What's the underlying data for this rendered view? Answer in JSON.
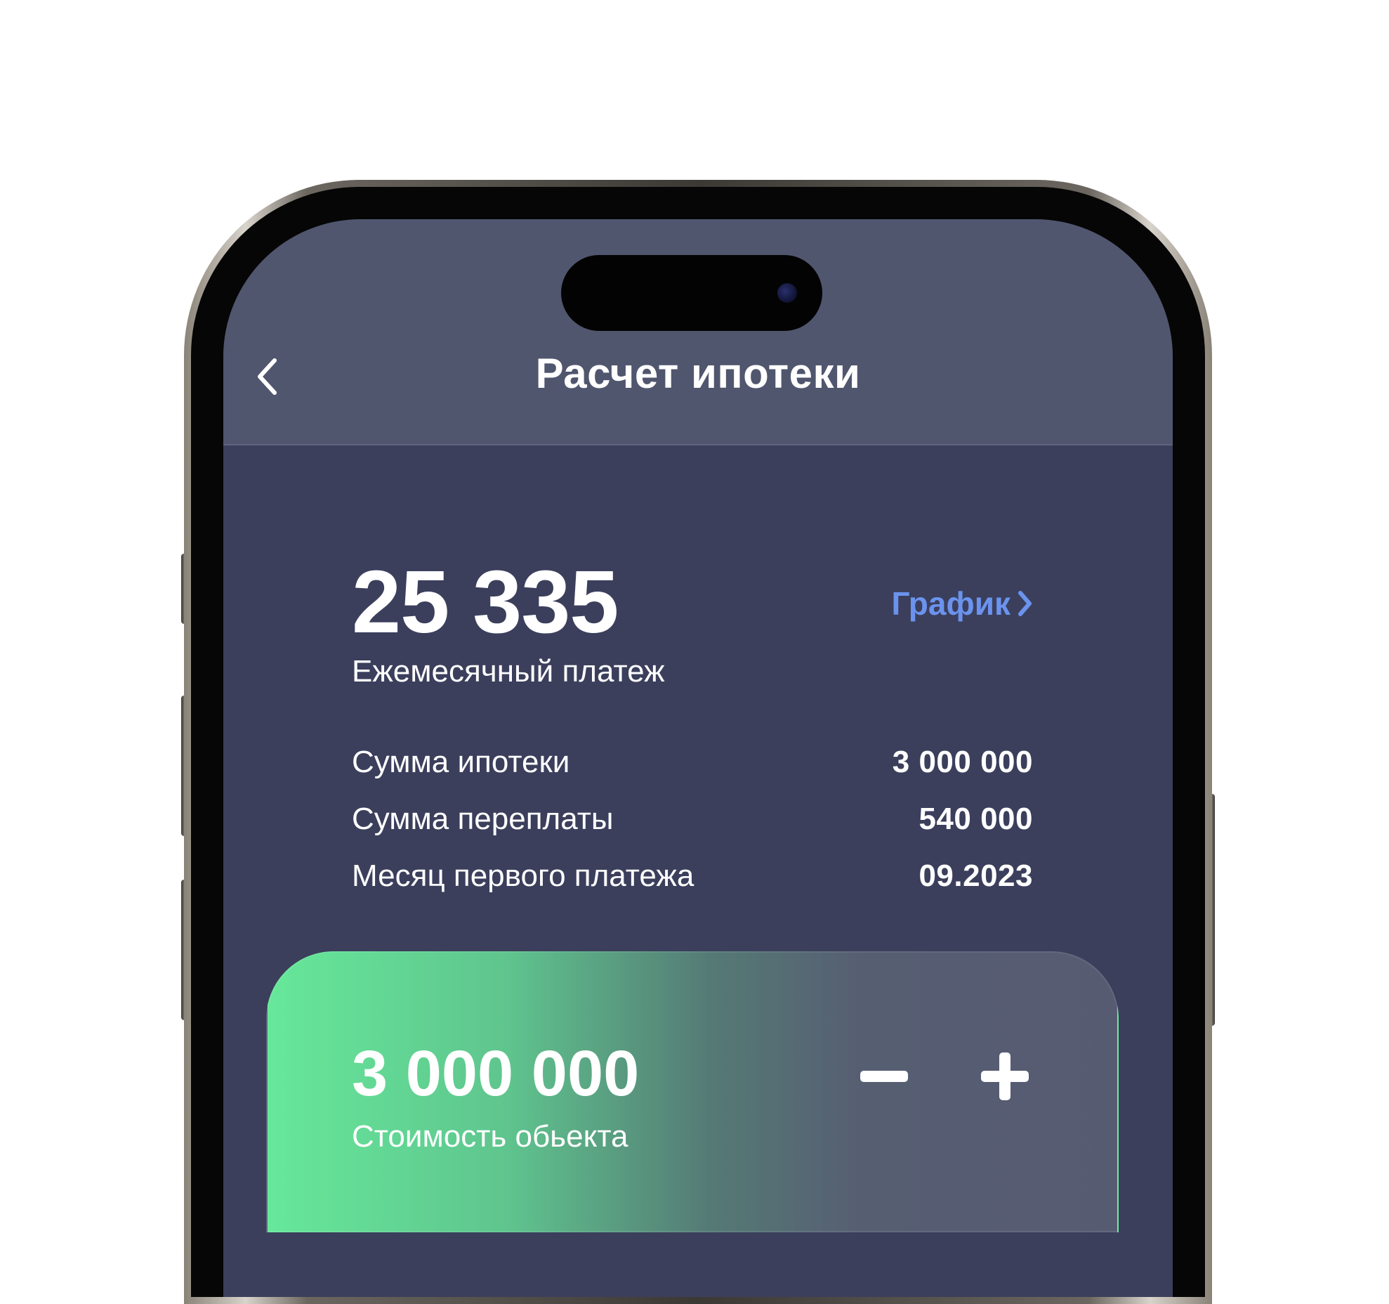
{
  "header": {
    "title": "Расчет ипотеки",
    "back_icon": "chevron-left-icon"
  },
  "summary": {
    "monthly_payment": "25 335",
    "monthly_payment_label": "Ежемесячный платеж",
    "schedule_link": "График",
    "schedule_icon": "chevron-right-icon",
    "rows": [
      {
        "label": "Сумма ипотеки",
        "value": "3 000 000"
      },
      {
        "label": "Сумма переплаты",
        "value": "540 000"
      },
      {
        "label": "Месяц первого платежа",
        "value": "09.2023"
      }
    ]
  },
  "price_card": {
    "value": "3 000 000",
    "label": "Стоимость обьекта",
    "decrement_icon": "minus-icon",
    "increment_icon": "plus-icon"
  },
  "colors": {
    "screen_background": "#3b3f5c",
    "navbar_background": "#51566f",
    "link_accent": "#6b93ee",
    "card_gradient_start": "#66e89a",
    "card_gradient_end": "#575b72"
  }
}
